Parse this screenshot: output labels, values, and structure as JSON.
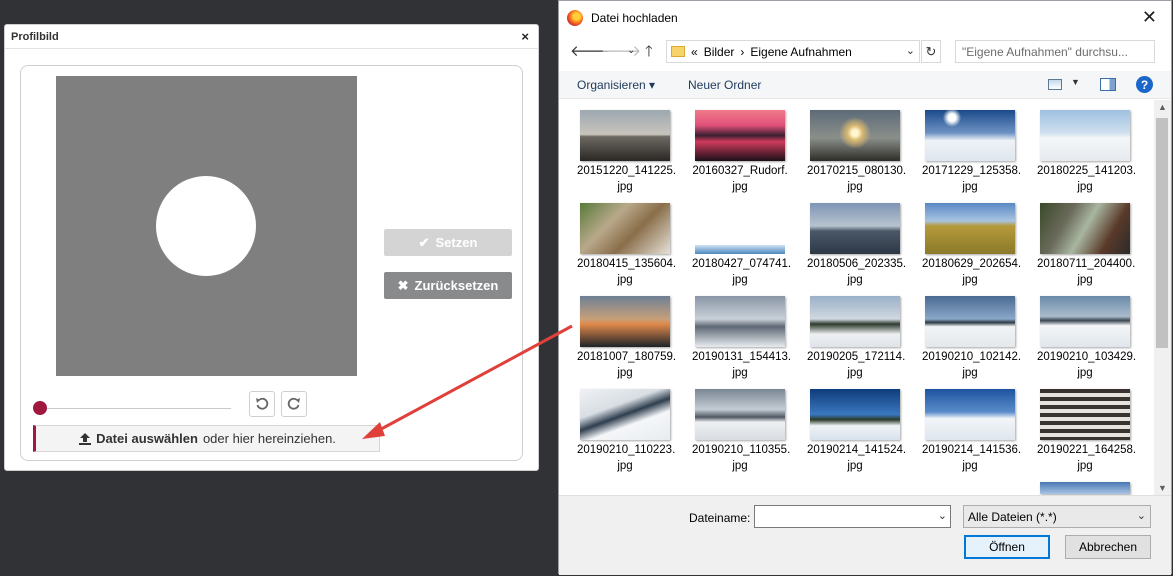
{
  "profile_dialog": {
    "title": "Profilbild",
    "close": "×",
    "set_label": "Setzen",
    "reset_label": "Zurücksetzen",
    "upload_bold": "Datei auswählen",
    "upload_rest": "oder hier hereinziehen."
  },
  "file_dialog": {
    "title": "Datei hochladen",
    "close": "✕",
    "breadcrumb_prefix": "«",
    "breadcrumb": [
      "Bilder",
      "Eigene Aufnahmen"
    ],
    "search_placeholder": "\"Eigene Aufnahmen\" durchsu...",
    "toolbar": {
      "organize": "Organisieren ▾",
      "new_folder": "Neuer Ordner",
      "help": "?"
    },
    "files": [
      {
        "name": "20151220_141225.\njpg"
      },
      {
        "name": "20160327_Rudorf.\njpg"
      },
      {
        "name": "20170215_080130.\njpg"
      },
      {
        "name": "20171229_125358.\njpg"
      },
      {
        "name": "20180225_141203.\njpg"
      },
      {
        "name": "20180415_135604.\njpg"
      },
      {
        "name": "20180427_074741.\njpg"
      },
      {
        "name": "20180506_202335.\njpg"
      },
      {
        "name": "20180629_202654.\njpg"
      },
      {
        "name": "20180711_204400.\njpg"
      },
      {
        "name": "20181007_180759.\njpg"
      },
      {
        "name": "20190131_154413.\njpg"
      },
      {
        "name": "20190205_172114.\njpg"
      },
      {
        "name": "20190210_102142.\njpg"
      },
      {
        "name": "20190210_103429.\njpg"
      },
      {
        "name": "20190210_110223.\njpg"
      },
      {
        "name": "20190210_110355.\njpg"
      },
      {
        "name": "20190214_141524.\njpg"
      },
      {
        "name": "20190214_141536.\njpg"
      },
      {
        "name": "20190221_164258.\njpg"
      },
      {
        "name": ""
      }
    ],
    "filename_label": "Dateiname:",
    "filename_value": "",
    "filetype_selected": "Alle Dateien (*.*)",
    "open_label": "Öffnen",
    "cancel_label": "Abbrechen"
  },
  "colors": {
    "accent": "#a01840",
    "arrow": "#e0403a",
    "crop_bg": "#7f7f7f"
  }
}
